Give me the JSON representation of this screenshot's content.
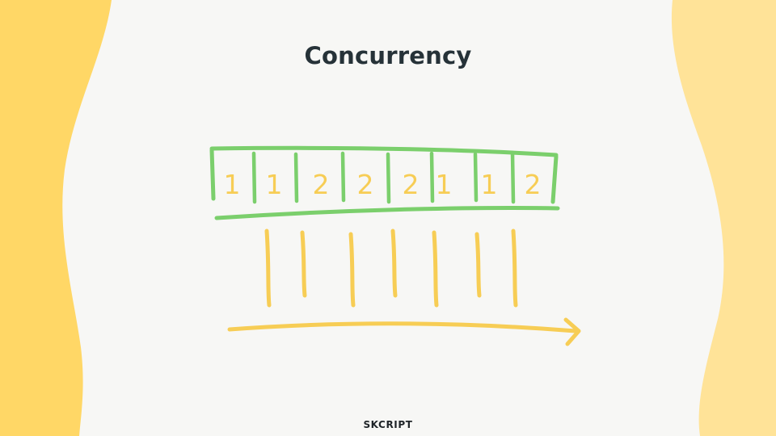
{
  "slide": {
    "title": "Concurrency",
    "brand": "SKCRIPT"
  },
  "colors": {
    "background": "#f7f7f5",
    "wave_left": "#ffd766",
    "wave_right": "#ffe398",
    "queue_stroke": "#7bcf6c",
    "task_yellow": "#f7cd55",
    "title_text": "#263238"
  },
  "queue": {
    "cells": [
      "1",
      "1",
      "2",
      "2",
      "2",
      "1",
      "1",
      "2"
    ]
  },
  "timeline": {
    "worker_lines": 7,
    "arrow_icon": "arrow-right-icon"
  }
}
